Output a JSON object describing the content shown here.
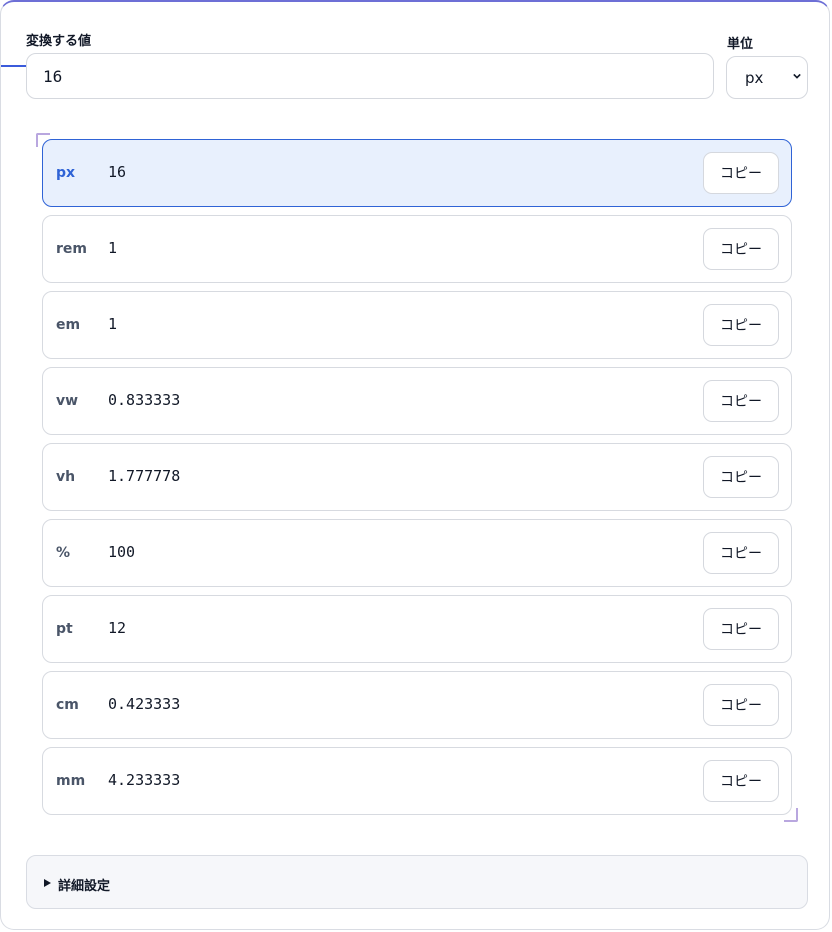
{
  "form": {
    "value_label": "変換する値",
    "value": "16",
    "unit_label": "単位",
    "unit_selected": "px"
  },
  "results": [
    {
      "unit": "px",
      "value": "16",
      "copy_label": "コピー",
      "active": true
    },
    {
      "unit": "rem",
      "value": "1",
      "copy_label": "コピー"
    },
    {
      "unit": "em",
      "value": "1",
      "copy_label": "コピー"
    },
    {
      "unit": "vw",
      "value": "0.833333",
      "copy_label": "コピー"
    },
    {
      "unit": "vh",
      "value": "1.777778",
      "copy_label": "コピー"
    },
    {
      "unit": "%",
      "value": "100",
      "copy_label": "コピー"
    },
    {
      "unit": "pt",
      "value": "12",
      "copy_label": "コピー"
    },
    {
      "unit": "cm",
      "value": "0.423333",
      "copy_label": "コピー"
    },
    {
      "unit": "mm",
      "value": "4.233333",
      "copy_label": "コピー"
    }
  ],
  "details": {
    "label": "詳細設定",
    "icon": "triangle-right-icon"
  },
  "colors": {
    "accent": "#2f63d6",
    "active_bg": "#e8f0fd",
    "top_border": "#6d6fd6"
  }
}
